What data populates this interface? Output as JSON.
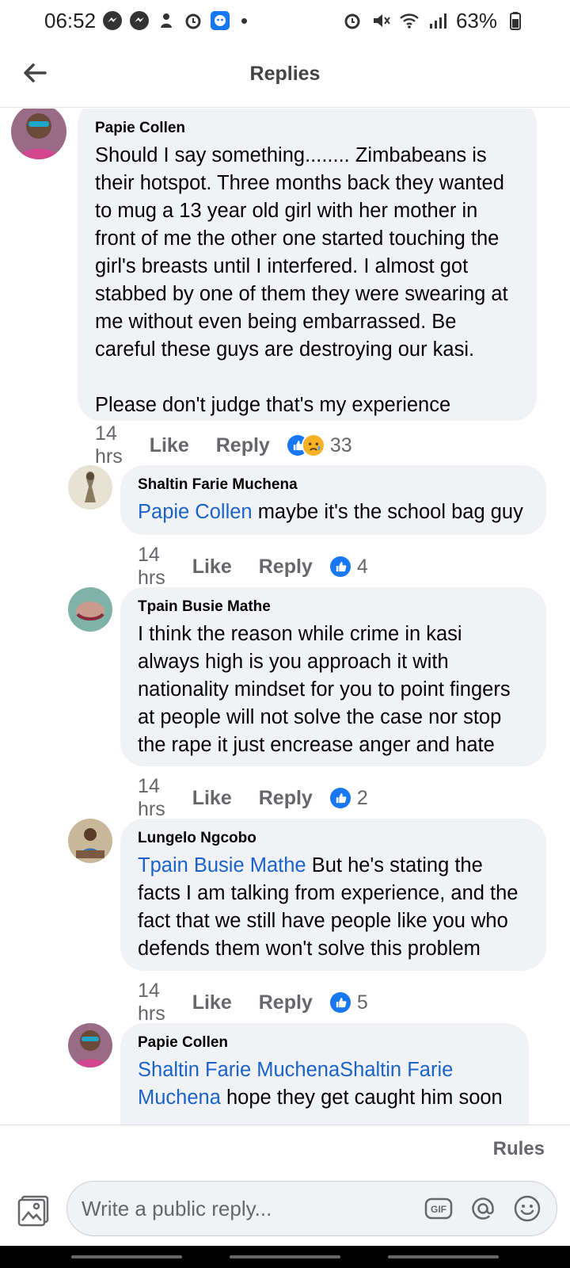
{
  "status_bar": {
    "time": "06:52",
    "battery": "63%"
  },
  "header": {
    "title": "Replies"
  },
  "comments": [
    {
      "author": "Papie Collen",
      "mention": "",
      "text": "Should I say something........ Zimbabeans is their hotspot. Three months back they wanted to mug a 13 year old girl with her mother in front of me the other one started touching the girl's breasts until I interfered. I almost got stabbed by one of them they were swearing at me without even being embarrassed. Be careful these guys are destroying our kasi.\n\nPlease don't judge that's my experience",
      "time": "14 hrs",
      "like": "Like",
      "reply": "Reply",
      "reactions": [
        "like-icon",
        "sad-icon"
      ],
      "reaction_count": "33"
    },
    {
      "author": "Shaltin Farie Muchena",
      "mention": "Papie Collen",
      "text": " maybe it's the school bag guy",
      "time": "14 hrs",
      "like": "Like",
      "reply": "Reply",
      "reactions": [
        "like-icon"
      ],
      "reaction_count": "4"
    },
    {
      "author": "Tpain Busie Mathe",
      "mention": "",
      "text": "I think the reason while crime in kasi always high is you approach it with nationality mindset for you to point fingers at people will not solve the case nor stop the rape it just encrease anger and hate",
      "time": "14 hrs",
      "like": "Like",
      "reply": "Reply",
      "reactions": [
        "like-icon"
      ],
      "reaction_count": "2"
    },
    {
      "author": "Lungelo Ngcobo",
      "mention": "Tpain Busie Mathe",
      "text": " But he's stating the facts I am talking from experience, and the fact that we still have people like you who defends them won't solve this problem",
      "time": "14 hrs",
      "like": "Like",
      "reply": "Reply",
      "reactions": [
        "like-icon"
      ],
      "reaction_count": "5"
    },
    {
      "author": "Papie Collen",
      "mention": "Shaltin Farie MuchenaShaltin Farie Muchena",
      "text": " hope they get caught him soon",
      "time": "",
      "like": "",
      "reply": "",
      "reactions": [],
      "reaction_count": ""
    }
  ],
  "footer": {
    "rules": "Rules",
    "placeholder": "Write a public reply..."
  },
  "colors": {
    "accent": "#1877f2",
    "mention": "#1b63c9",
    "bubble": "#f0f2f5",
    "meta": "#65676b"
  }
}
